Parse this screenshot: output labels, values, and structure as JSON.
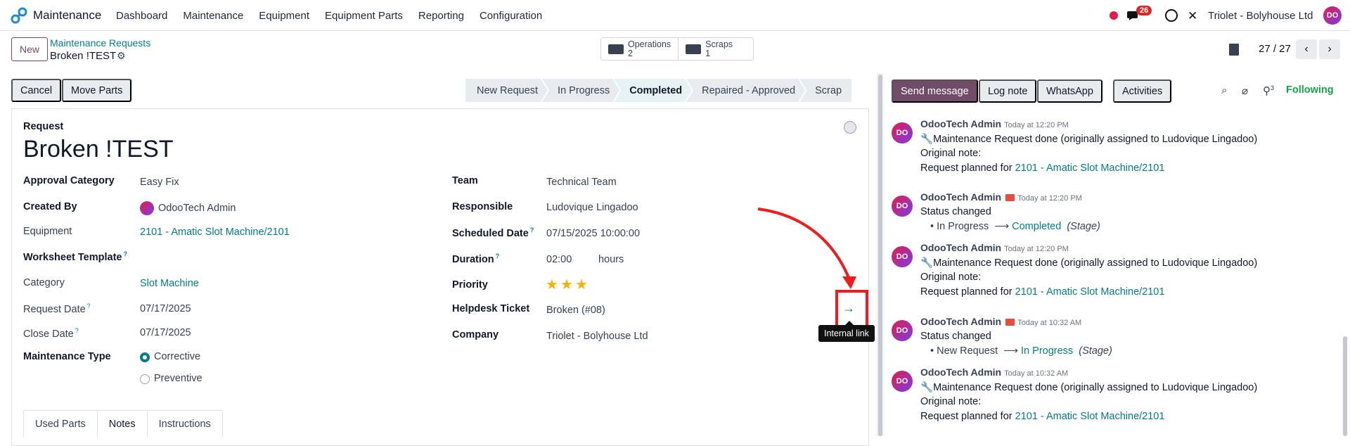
{
  "app": {
    "name": "Maintenance"
  },
  "nav": [
    "Dashboard",
    "Maintenance",
    "Equipment",
    "Equipment Parts",
    "Reporting",
    "Configuration"
  ],
  "systray": {
    "message_count": "26",
    "company": "Triolet - Bolyhouse Ltd",
    "avatar": "DO"
  },
  "control": {
    "new_label": "New",
    "breadcrumb_parent": "Maintenance Requests",
    "breadcrumb_current": "Broken !TEST",
    "smart_buttons": [
      {
        "label": "Operations",
        "count": "2"
      },
      {
        "label": "Scraps",
        "count": "1"
      }
    ],
    "pager": "27 / 27"
  },
  "statusbar": {
    "cancel": "Cancel",
    "move_parts": "Move Parts",
    "stages": [
      "New Request",
      "In Progress",
      "Completed",
      "Repaired - Approved",
      "Scrap"
    ],
    "active_stage": "Completed"
  },
  "form": {
    "request_label": "Request",
    "title": "Broken !TEST",
    "left": {
      "approval_category": {
        "label": "Approval Category",
        "value": "Easy Fix"
      },
      "created_by": {
        "label": "Created By",
        "value": "OdooTech Admin"
      },
      "equipment": {
        "label": "Equipment",
        "value": "2101 - Amatic Slot Machine/2101"
      },
      "worksheet_template": {
        "label": "Worksheet Template",
        "help": "?"
      },
      "category": {
        "label": "Category",
        "value": "Slot Machine"
      },
      "request_date": {
        "label": "Request Date",
        "help": "?",
        "value": "07/17/2025"
      },
      "close_date": {
        "label": "Close Date",
        "help": "?",
        "value": "07/17/2025"
      },
      "maintenance_type": {
        "label": "Maintenance Type",
        "options": [
          "Corrective",
          "Preventive"
        ],
        "selected": "Corrective"
      }
    },
    "right": {
      "team": {
        "label": "Team",
        "value": "Technical Team"
      },
      "responsible": {
        "label": "Responsible",
        "value": "Ludovique Lingadoo"
      },
      "scheduled_date": {
        "label": "Scheduled Date",
        "help": "?",
        "value": "07/15/2025 10:00:00"
      },
      "duration": {
        "label": "Duration",
        "help": "?",
        "value": "02:00",
        "unit": "hours"
      },
      "priority": {
        "label": "Priority",
        "stars": 3,
        "max": 3
      },
      "helpdesk_ticket": {
        "label": "Helpdesk Ticket",
        "value": "Broken (#08)"
      },
      "company": {
        "label": "Company",
        "value": "Triolet - Bolyhouse Ltd"
      }
    },
    "tabs": [
      "Used Parts",
      "Notes",
      "Instructions"
    ],
    "active_tab": "Notes",
    "tooltip": "Internal link"
  },
  "chatter": {
    "send_message": "Send message",
    "log_note": "Log note",
    "whatsapp": "WhatsApp",
    "activities": "Activities",
    "followers_count": "3",
    "following": "Following",
    "messages": [
      {
        "author": "OdooTech Admin",
        "time": "Today at 12:20 PM",
        "lines": [
          "Maintenance Request done (originally assigned to Ludovique Lingadoo)",
          "Original note:"
        ],
        "planned_prefix": "Request planned for ",
        "planned_link": "2101 - Amatic Slot Machine/2101"
      },
      {
        "author": "OdooTech Admin",
        "time": "Today at 12:20 PM",
        "status": "Status changed",
        "from": "In Progress",
        "to": "Completed",
        "field": "(Stage)"
      },
      {
        "author": "OdooTech Admin",
        "time": "Today at 12:20 PM",
        "lines": [
          "Maintenance Request done (originally assigned to Ludovique Lingadoo)",
          "Original note:"
        ],
        "planned_prefix": "Request planned for ",
        "planned_link": "2101 - Amatic Slot Machine/2101"
      },
      {
        "author": "OdooTech Admin",
        "time": "Today at 10:32 AM",
        "status": "Status changed",
        "from": "New Request",
        "to": "In Progress",
        "field": "(Stage)"
      },
      {
        "author": "OdooTech Admin",
        "time": "Today at 10:32 AM",
        "lines": [
          "Maintenance Request done (originally assigned to Ludovique Lingadoo)",
          "Original note:"
        ],
        "planned_prefix": "Request planned for ",
        "planned_link": "2101 - Amatic Slot Machine/2101"
      }
    ]
  },
  "colors": {
    "brand": "#714b67",
    "link": "#017e84",
    "alert": "#ef1c1c"
  }
}
